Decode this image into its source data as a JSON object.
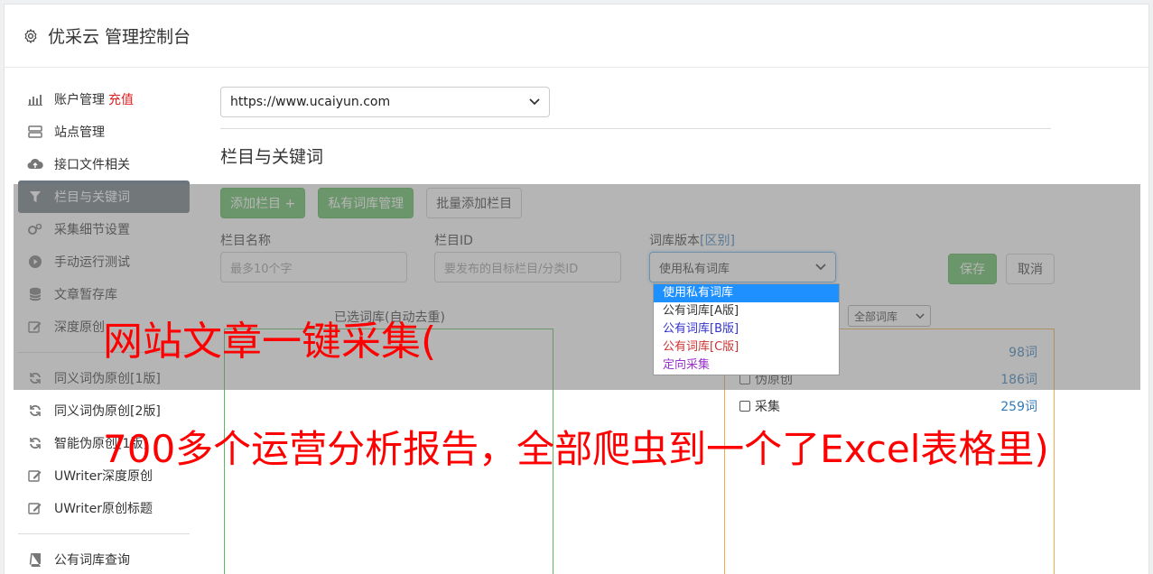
{
  "app": {
    "title": "优采云 管理控制台"
  },
  "sidebar": {
    "items": [
      {
        "label": "账户管理",
        "extra": "充值"
      },
      {
        "label": "站点管理"
      },
      {
        "label": "接口文件相关"
      },
      {
        "label": "栏目与关键词"
      },
      {
        "label": "采集细节设置"
      },
      {
        "label": "手动运行测试"
      },
      {
        "label": "文章暂存库"
      },
      {
        "label": "深度原创"
      },
      {
        "label": "同义词伪原创[1版]"
      },
      {
        "label": "同义词伪原创[2版]"
      },
      {
        "label": "智能伪原创[1版]"
      },
      {
        "label": "UWriter深度原创"
      },
      {
        "label": "UWriter原创标题"
      },
      {
        "label": "公有词库查询"
      }
    ]
  },
  "main": {
    "site_select": "https://www.ucaiyun.com",
    "section_title": "栏目与关键词",
    "buttons": {
      "add_column": "添加栏目 +",
      "private_lib": "私有词库管理",
      "batch_add": "批量添加栏目"
    },
    "form": {
      "column_name_label": "栏目名称",
      "column_name_placeholder": "最多10个字",
      "column_id_label": "栏目ID",
      "column_id_placeholder": "要发布的目标栏目/分类ID",
      "lib_version_label": "词库版本",
      "lib_version_link": "[区别]",
      "lib_version_value": "使用私有词库",
      "save": "保存",
      "cancel": "取消"
    },
    "dropdown_options": [
      {
        "label": "使用私有词库",
        "color": "#ffffff"
      },
      {
        "label": "公有词库[A版]",
        "color": "#333333"
      },
      {
        "label": "公有词库[B版]",
        "color": "#3333cc"
      },
      {
        "label": "公有词库[C版]",
        "color": "#cc3333"
      },
      {
        "label": "定向采集",
        "color": "#9933cc"
      }
    ],
    "selected_label": "已选词库(自动去重)",
    "lib_filter": "全部词库",
    "libraries": [
      {
        "name": "",
        "count": "98词"
      },
      {
        "name": "伪原创",
        "count": "186词"
      },
      {
        "name": "采集",
        "count": "259词"
      }
    ]
  },
  "banner": {
    "line1": "网站文章一键采集(",
    "line2": "700多个运营分析报告，全部爬虫到一个了Excel表格里)"
  }
}
